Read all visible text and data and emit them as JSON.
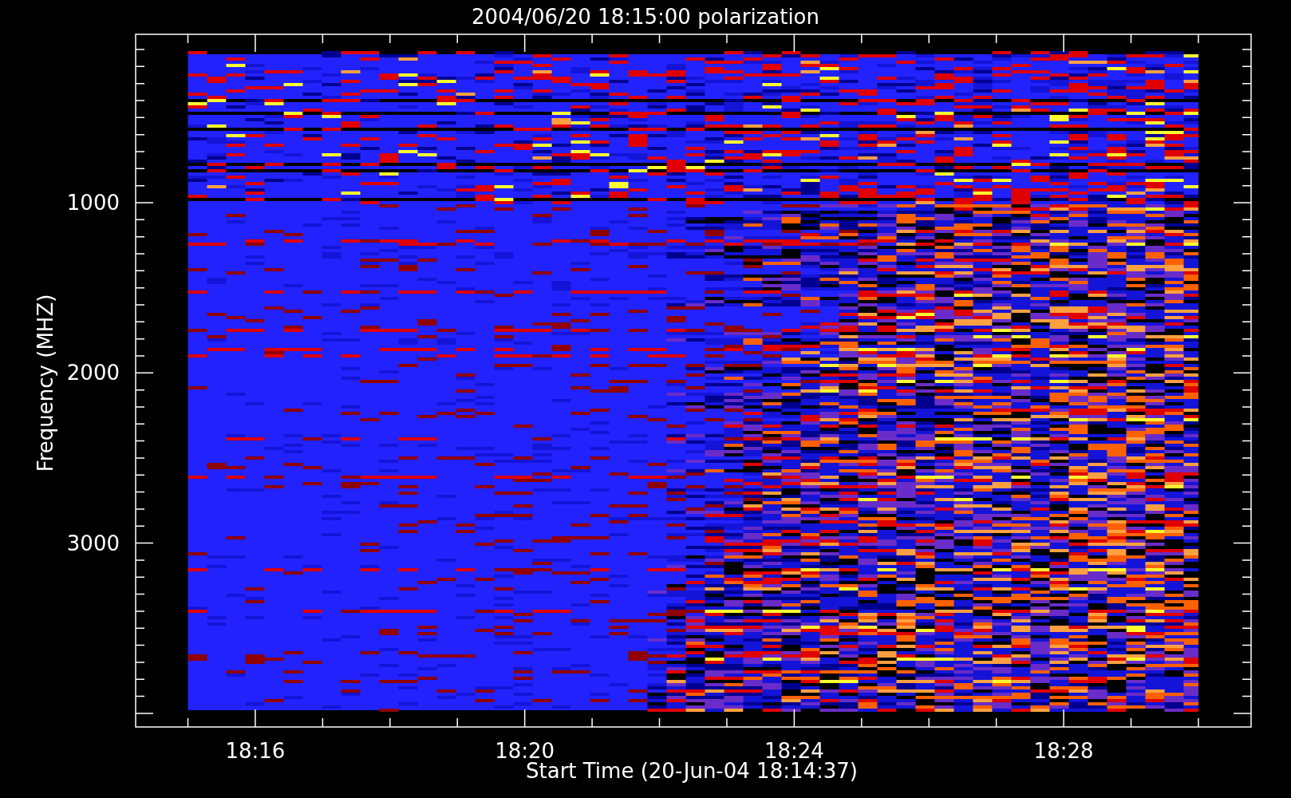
{
  "title": "2004/06/20 18:15:00 polarization",
  "plot": {
    "xlabel": "Start Time (20-Jun-04 18:14:37)",
    "ylabel": "Frequency (MHZ)",
    "xticks": [
      "18:16",
      "18:20",
      "18:24",
      "18:28"
    ],
    "yticks": [
      "1000",
      "2000",
      "3000"
    ]
  }
}
